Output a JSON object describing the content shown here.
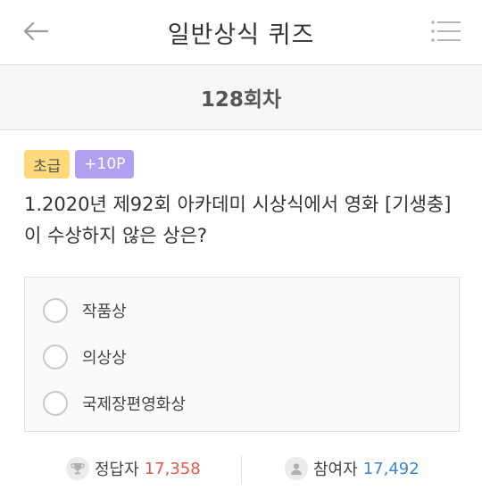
{
  "header": {
    "title": "일반상식 퀴즈",
    "back_icon": "arrow-left-icon",
    "menu_icon": "list-menu-icon"
  },
  "round": {
    "label": "128회차"
  },
  "question": {
    "level_badge": "초급",
    "points_badge": "+10P",
    "text": "1.2020년 제92회 아카데미 시상식에서 영화 [기생충]이 수상하지 않은 상은?",
    "options": [
      "작품상",
      "의상상",
      "국제장편영화상"
    ]
  },
  "stats": {
    "correct_label": "정답자",
    "correct_value": "17,358",
    "participants_label": "참여자",
    "participants_value": "17,492"
  },
  "colors": {
    "level_badge": "#ffd97a",
    "points_badge": "#b1a0f0",
    "correct_value": "#e8554e",
    "participants_value": "#3e86c9"
  }
}
